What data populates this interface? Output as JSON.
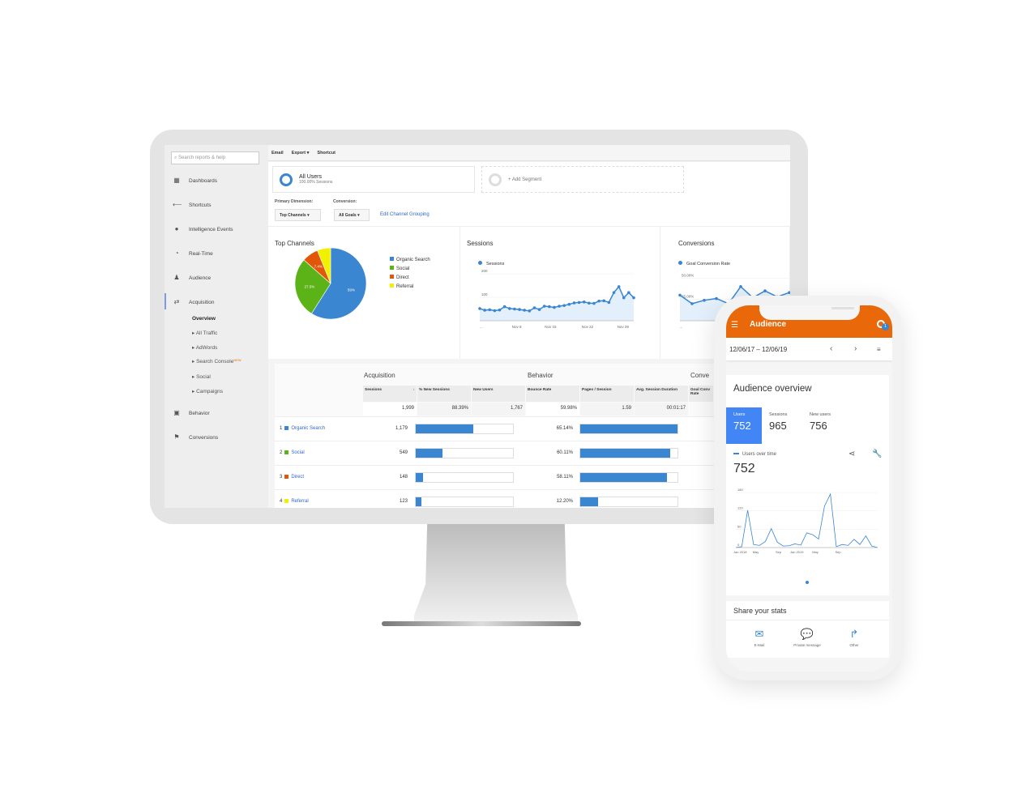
{
  "ga": {
    "search_placeholder": "Search reports & help",
    "toolbar": [
      "Email",
      "Export ▾",
      "Shortcut"
    ],
    "sidebar": {
      "items": [
        {
          "label": "Dashboards",
          "icon": "grid-icon"
        },
        {
          "label": "Shortcuts",
          "icon": "shortcut-arrows-icon"
        },
        {
          "label": "Intelligence Events",
          "icon": "lightbulb-icon"
        },
        {
          "label": "Real-Time",
          "icon": "clock-icon"
        },
        {
          "label": "Audience",
          "icon": "people-icon"
        },
        {
          "label": "Acquisition",
          "icon": "acquisition-arrows-icon"
        },
        {
          "label": "Behavior",
          "icon": "behavior-layout-icon"
        },
        {
          "label": "Conversions",
          "icon": "flag-icon"
        }
      ],
      "subitems": [
        "Overview",
        "▸ All Traffic",
        "▸ AdWords",
        "▸ Search Console",
        "▸ Social",
        "▸ Campaigns"
      ],
      "new_badge": "NEW"
    },
    "segments": {
      "all_users": "All Users",
      "all_users_sub": "100.00% Sessions",
      "add_segment": "+ Add Segment"
    },
    "filters": {
      "primary_dimension_label": "Primary Dimension:",
      "primary_dimension_value": "Top Channels",
      "conversion_label": "Conversion:",
      "conversion_value": "All Goals",
      "edit_link": "Edit Channel Grouping"
    },
    "cards": {
      "top_channels": "Top Channels",
      "sessions": "Sessions",
      "sessions_legend": "Sessions",
      "conversions": "Conversions",
      "conversions_legend": "Goal Conversion Rate"
    },
    "table": {
      "groups": [
        "Acquisition",
        "Behavior",
        "Conve"
      ],
      "columns": [
        "Sessions",
        "% New Sessions",
        "New Users",
        "Bounce Rate",
        "Pages / Session",
        "Avg. Session Duration",
        "Goal Conv Rate"
      ],
      "totals": [
        "1,999",
        "88.39%",
        "1,767",
        "59.98%",
        "1.59",
        "00:01:17"
      ],
      "rows": [
        {
          "n": "1",
          "label": "Organic Search",
          "color": "#3a86d0",
          "sessions": "1,179",
          "sessions_share": 0.59,
          "bounce": "65.14%",
          "bounce_frac": 0.6514
        },
        {
          "n": "2",
          "label": "Social",
          "color": "#5bb318",
          "sessions": "549",
          "sessions_share": 0.275,
          "bounce": "60.11%",
          "bounce_frac": 0.6011
        },
        {
          "n": "3",
          "label": "Direct",
          "color": "#e2560a",
          "sessions": "148",
          "sessions_share": 0.074,
          "bounce": "58.11%",
          "bounce_frac": 0.5811
        },
        {
          "n": "4",
          "label": "Referral",
          "color": "#f0f000",
          "sessions": "123",
          "sessions_share": 0.062,
          "bounce": "12.20%",
          "bounce_frac": 0.122
        }
      ]
    }
  },
  "phone": {
    "title": "Audience",
    "notification_count": "1",
    "date_range": "12/06/17 – 12/06/19",
    "overview_title": "Audience overview",
    "metrics": [
      {
        "label": "Users",
        "value": "752"
      },
      {
        "label": "Sessions",
        "value": "965"
      },
      {
        "label": "New users",
        "value": "756"
      }
    ],
    "chart_label": "Users over time",
    "chart_value": "752",
    "share_title": "Share your stats",
    "share": [
      {
        "label": "E-Mail",
        "icon": "mail-icon"
      },
      {
        "label": "Private message",
        "icon": "chat-icon"
      },
      {
        "label": "Other",
        "icon": "share-arrow-icon"
      }
    ]
  },
  "chart_data": [
    {
      "type": "pie",
      "title": "Top Channels",
      "categories": [
        "Organic Search",
        "Social",
        "Direct",
        "Referral"
      ],
      "values": [
        59,
        27.5,
        7.4,
        6.1
      ],
      "labels": [
        "59%",
        "27.5%",
        "7.4%",
        ""
      ],
      "colors": [
        "#3a86d0",
        "#5bb318",
        "#e2560a",
        "#f0f000"
      ],
      "legend": "right"
    },
    {
      "type": "area",
      "title": "Sessions",
      "series": [
        {
          "name": "Sessions",
          "values": [
            52,
            45,
            47,
            43,
            46,
            60,
            52,
            50,
            48,
            45,
            42,
            55,
            48,
            62,
            60,
            57,
            62,
            65,
            70,
            76,
            78,
            80,
            75,
            74,
            84,
            85,
            78,
            120,
            145,
            98,
            120,
            98
          ]
        }
      ],
      "x_ticks": [
        "...",
        "Nov 8",
        "Nov 15",
        "Nov 22",
        "Nov 29"
      ],
      "y_ticks": [
        "100",
        "200"
      ],
      "ylim": [
        0,
        200
      ]
    },
    {
      "type": "area",
      "title": "Conversions",
      "series": [
        {
          "name": "Goal Conversion Rate",
          "values": [
            30,
            20,
            24,
            26,
            20,
            40,
            27,
            35,
            28,
            33
          ]
        }
      ],
      "x_ticks": [
        "..."
      ],
      "y_ticks": [
        "25.00%",
        "50.00%"
      ],
      "ylim": [
        0,
        55
      ]
    },
    {
      "type": "line",
      "title": "Users over time",
      "series": [
        {
          "name": "Users",
          "values": [
            0,
            3,
            122,
            10,
            7,
            20,
            62,
            18,
            5,
            6,
            12,
            8,
            48,
            42,
            28,
            135,
            175,
            3,
            10,
            7,
            27,
            10,
            38,
            5,
            0
          ]
        }
      ],
      "x_ticks": [
        "Jan 2018",
        "May",
        "Sep",
        "Jan 2019",
        "May",
        "Sep"
      ],
      "y_ticks": [
        "0",
        "60",
        "120",
        "180"
      ],
      "ylim": [
        0,
        180
      ]
    }
  ]
}
